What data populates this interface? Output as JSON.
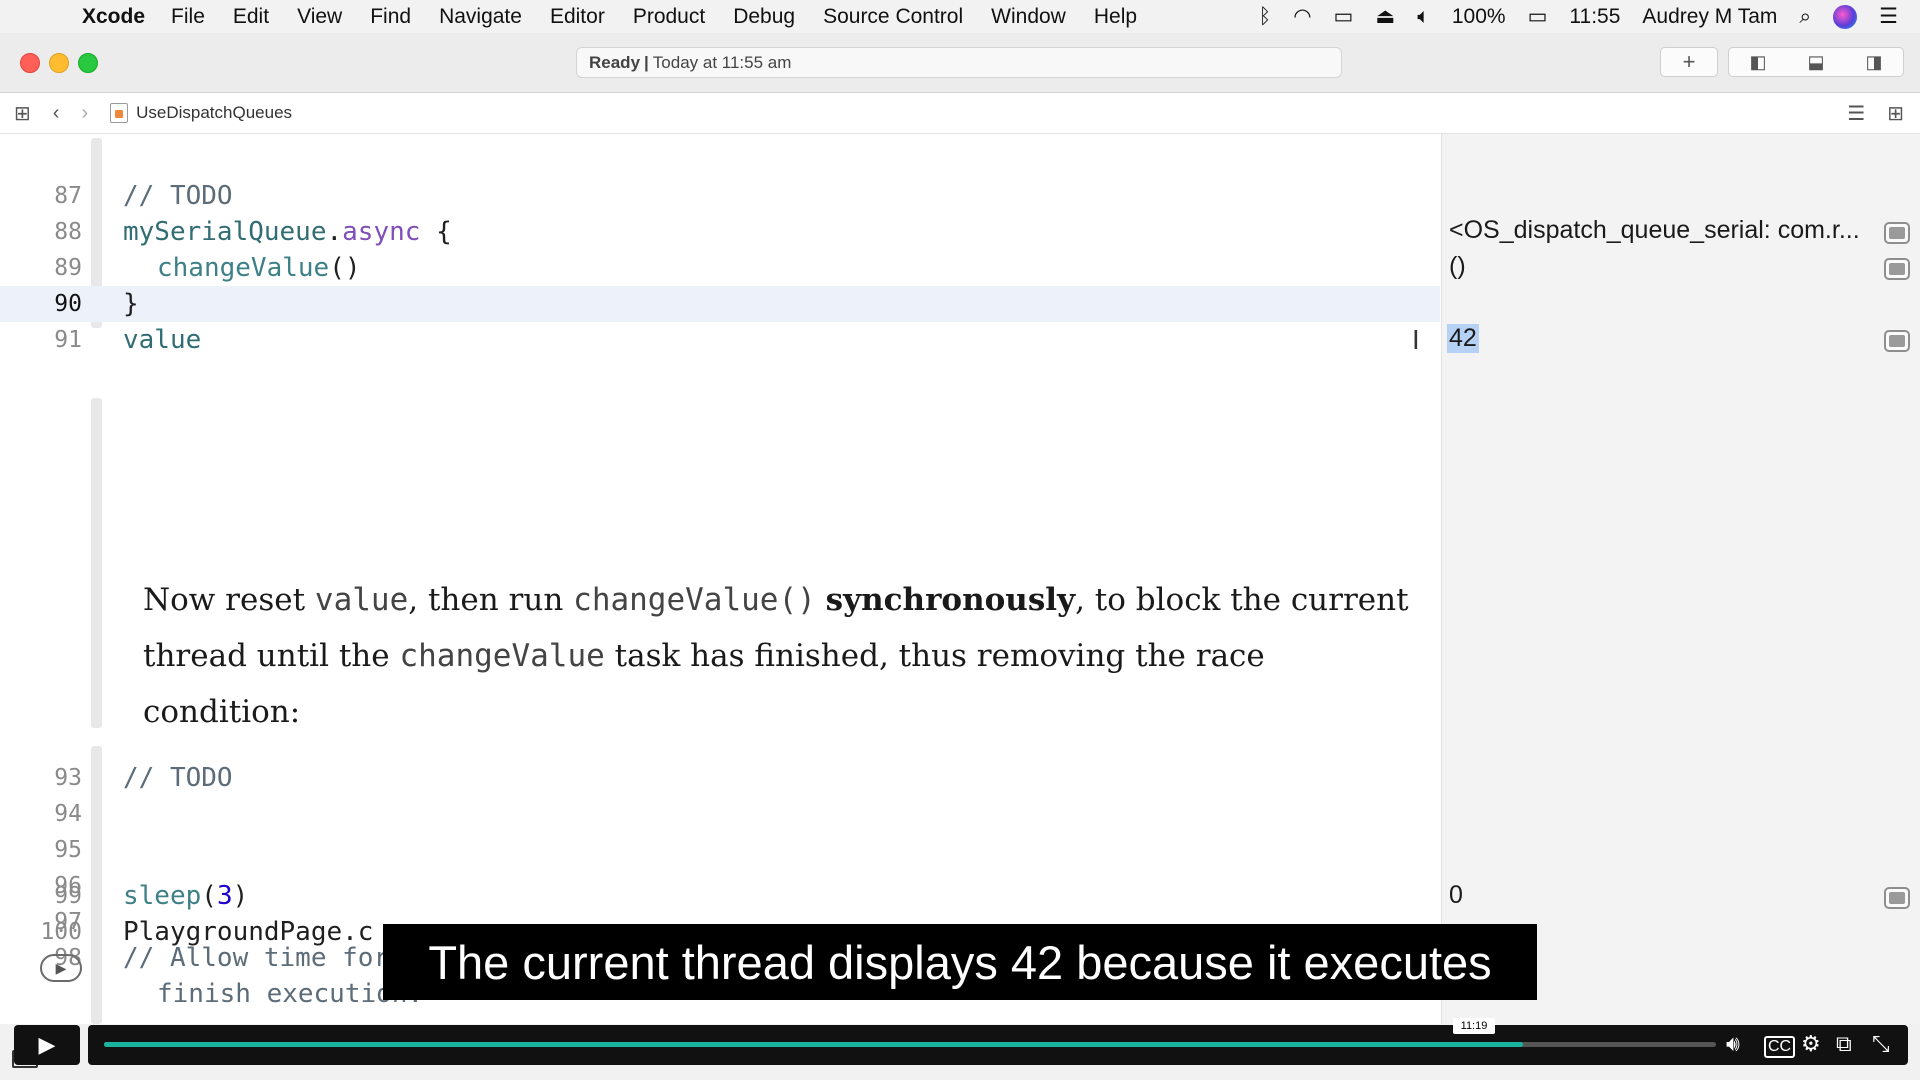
{
  "menubar": {
    "app": "Xcode",
    "items": [
      "File",
      "Edit",
      "View",
      "Find",
      "Navigate",
      "Editor",
      "Product",
      "Debug",
      "Source Control",
      "Window",
      "Help"
    ],
    "battery": "100%",
    "time": "11:55",
    "user": "Audrey M Tam"
  },
  "window": {
    "status_state": "Ready",
    "status_separator": "|",
    "status_detail": "Today at 11:55 am"
  },
  "jumpbar": {
    "file": "UseDispatchQueues"
  },
  "editor": {
    "lines": [
      {
        "n": "87",
        "text": "// TODO"
      },
      {
        "n": "88",
        "ident": "mySerialQueue",
        "dot": ".",
        "method": "async",
        "rest": " {"
      },
      {
        "n": "89",
        "func": "changeValue",
        "rest": "()"
      },
      {
        "n": "90",
        "text": "}"
      },
      {
        "n": "91",
        "ident": "value"
      },
      {
        "n": "93",
        "text": "// TODO"
      },
      {
        "n": "94"
      },
      {
        "n": "95"
      },
      {
        "n": "96"
      },
      {
        "n": "97"
      },
      {
        "n": "98",
        "text": "// Allow time for sleeping tasks to finish before letting the playground",
        "cont": "finish execution:"
      },
      {
        "n": "99",
        "func": "sleep",
        "open": "(",
        "num": "3",
        "close": ")"
      },
      {
        "n": "100",
        "text": "PlaygroundPage.c"
      }
    ],
    "current_line": "90",
    "prose": {
      "p1": "Now reset ",
      "m1": "value",
      "p2": ", then run ",
      "m2": "changeValue()",
      "p3": " ",
      "b1": "synchronously",
      "p4": ", to block the current thread until the ",
      "m3": "changeValue",
      "p5": " task has finished, thus removing the race condition:"
    }
  },
  "results": {
    "r88": "<OS_dispatch_queue_serial: com.r...",
    "r89": "()",
    "r91": "42",
    "r99": "0"
  },
  "subtitle": "The current thread displays 42 because it executes",
  "video": {
    "time_tooltip": "11:19",
    "progress": 0.88
  }
}
